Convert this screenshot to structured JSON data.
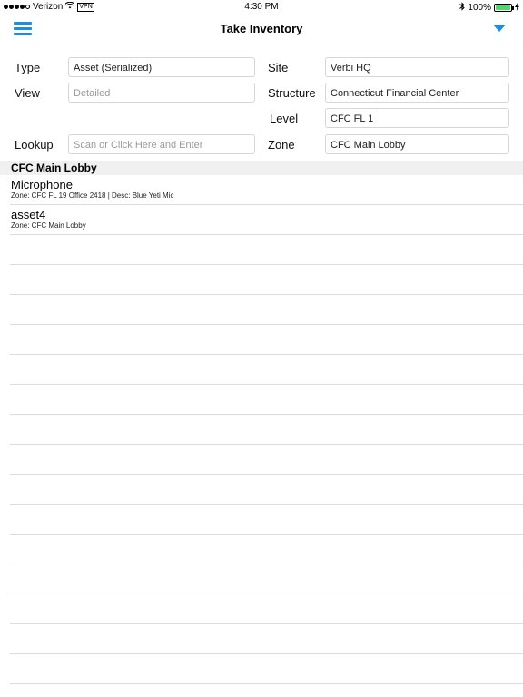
{
  "status_bar": {
    "carrier": "Verizon",
    "vpn": "VPN",
    "time": "4:30 PM",
    "battery_percent": "100%",
    "battery_level": 1.0,
    "battery_color": "#4cd964"
  },
  "nav": {
    "title": "Take Inventory",
    "menu_icon": "hamburger-icon",
    "dropdown_icon": "triangle-down-icon",
    "accent_color": "#1a8ee6"
  },
  "form": {
    "type_label": "Type",
    "type_value": "Asset (Serialized)",
    "view_label": "View",
    "view_placeholder": "Detailed",
    "lookup_label": "Lookup",
    "lookup_placeholder": "Scan or Click Here and Enter",
    "site_label": "Site",
    "site_value": "Verbi HQ",
    "structure_label": "Structure",
    "structure_value": "Connecticut Financial Center",
    "level_label": "Level",
    "level_value": "CFC FL 1",
    "zone_label": "Zone",
    "zone_value": "CFC Main Lobby"
  },
  "list": {
    "section_title": "CFC Main Lobby",
    "items": [
      {
        "title": "Microphone",
        "subtitle": "Zone: CFC FL 19 Office 2418 | Desc: Blue Yeti Mic"
      },
      {
        "title": "asset4",
        "subtitle": "Zone: CFC Main Lobby"
      }
    ]
  }
}
